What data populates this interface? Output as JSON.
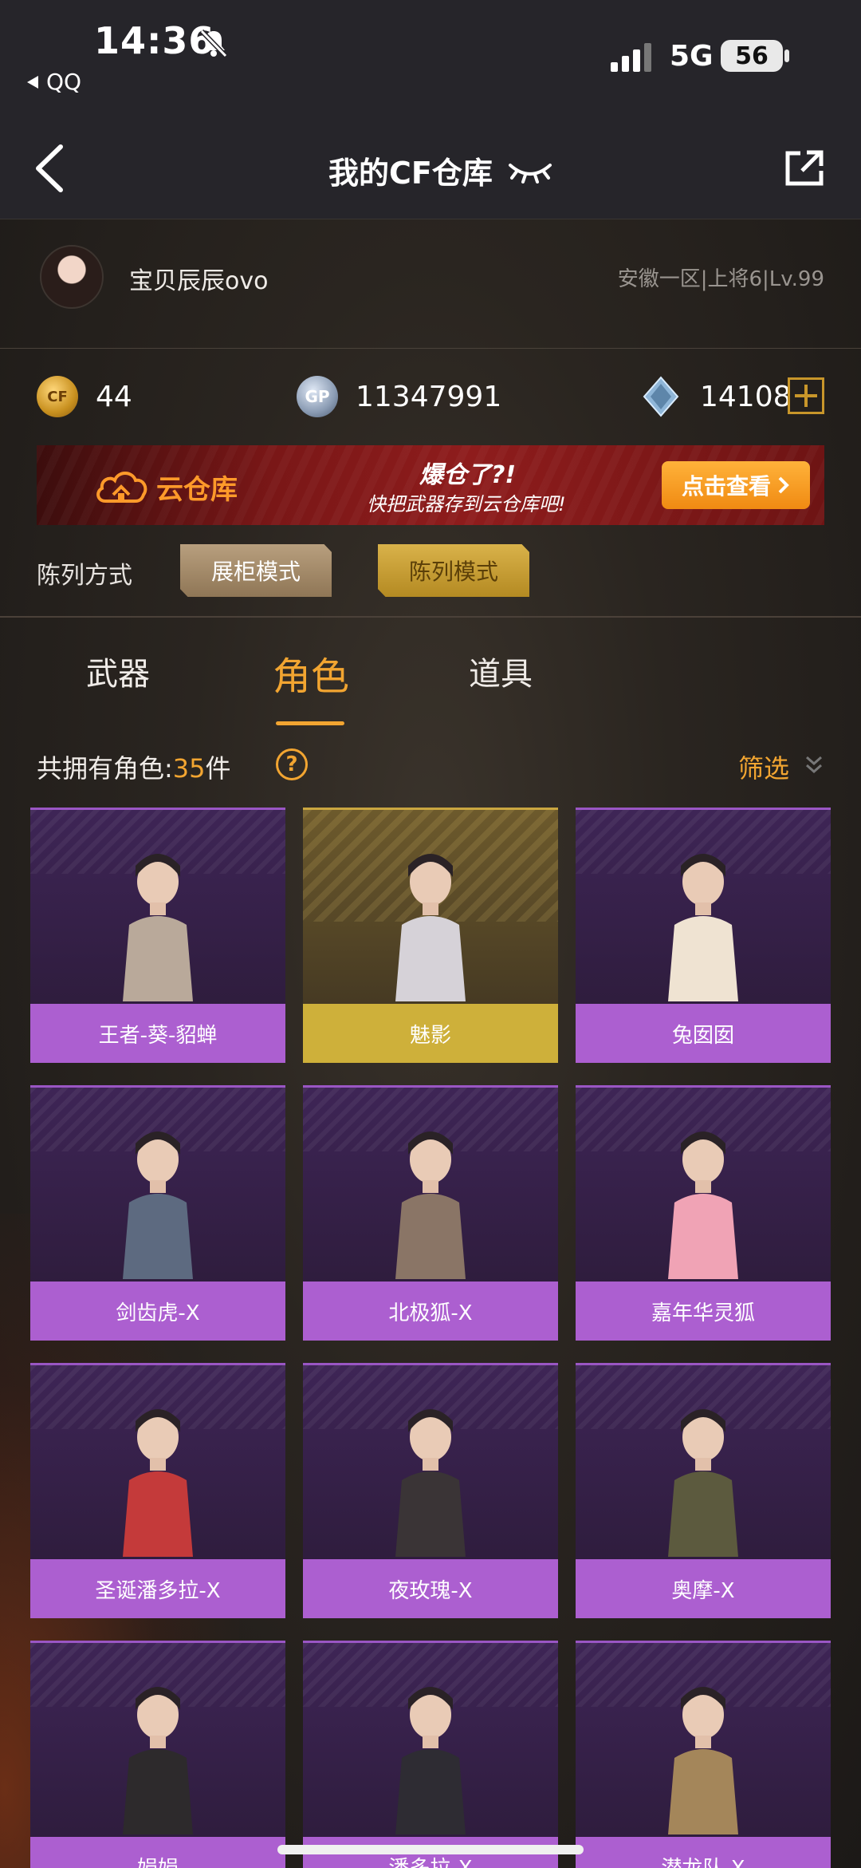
{
  "status_bar": {
    "time": "14:36",
    "back_app": "QQ",
    "network": "5G",
    "battery": "56"
  },
  "nav": {
    "title": "我的CF仓库"
  },
  "profile": {
    "username": "宝贝辰辰ovo",
    "server_info": "安徽一区|上将6|Lv.99"
  },
  "currency": {
    "cf_coin_label": "CF",
    "cf": "44",
    "gp_label": "GP",
    "gp": "11347991",
    "diamond": "14108"
  },
  "banner": {
    "cloud_label": "云仓库",
    "headline": "爆仓了?!",
    "subtext": "快把武器存到云仓库吧!",
    "button": "点击查看"
  },
  "display_mode": {
    "label": "陈列方式",
    "cabinet": "展柜模式",
    "list": "陈列模式"
  },
  "tabs": {
    "weapons": "武器",
    "roles": "角色",
    "items": "道具"
  },
  "owned": {
    "prefix": "共拥有角色:",
    "count": "35",
    "unit": "件",
    "help": "?",
    "filter": "筛选"
  },
  "characters": [
    {
      "name": "王者-葵-貂蝉",
      "tier": "purple",
      "tone": "#b9a99a"
    },
    {
      "name": "魅影",
      "tier": "gold",
      "tone": "#d6d2d8"
    },
    {
      "name": "兔囡囡",
      "tier": "purple",
      "tone": "#efe3d2"
    },
    {
      "name": "剑齿虎-X",
      "tier": "purple",
      "tone": "#5d6a80"
    },
    {
      "name": "北极狐-X",
      "tier": "purple",
      "tone": "#8a7566"
    },
    {
      "name": "嘉年华灵狐",
      "tier": "purple",
      "tone": "#f0a3b5"
    },
    {
      "name": "圣诞潘多拉-X",
      "tier": "purple",
      "tone": "#c43a3a"
    },
    {
      "name": "夜玫瑰-X",
      "tier": "purple",
      "tone": "#3a3436"
    },
    {
      "name": "奥摩-X",
      "tier": "purple",
      "tone": "#5c5a3e"
    },
    {
      "name": "娟娟",
      "tier": "purple",
      "tone": "#2d2a2c"
    },
    {
      "name": "潘多拉-X",
      "tier": "purple",
      "tone": "#2e2c33"
    },
    {
      "name": "潜龙队-X",
      "tier": "purple",
      "tone": "#a4865a"
    }
  ],
  "colors": {
    "accent": "#f2a531",
    "purple_label": "#ac5fd0",
    "gold_label": "#ceb03a"
  }
}
